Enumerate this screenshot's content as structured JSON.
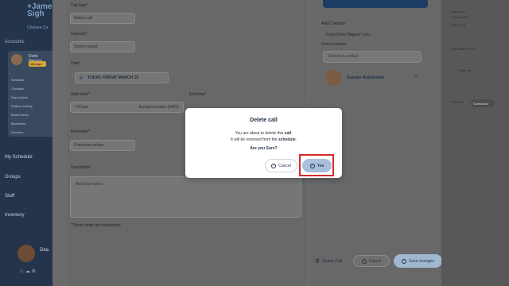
{
  "brand": {
    "logo_line1": "+Jame",
    "logo_line2": "Sigh",
    "subtitle": "Chelsea Ca"
  },
  "sidebar": {
    "accounts_label": "Accounts",
    "user_name": "Doris Hegues",
    "user_badge": "Manage",
    "items": [
      "Schedule",
      "Contacts",
      "Day Actions",
      "Rhibico Activity",
      "Board Items",
      "Biomettics",
      "Services"
    ],
    "nav": [
      "My Schedule",
      "Groups",
      "Staff",
      "Inventory"
    ],
    "footer_name": "Dea"
  },
  "form": {
    "call_type_label": "Call type*",
    "call_type_placeholder": "Select call",
    "repeats_label": "Repeats*",
    "repeats_placeholder": "Select repeat",
    "date_label": "Date*",
    "date_value": "TODAY, FRIDAY MARCH 15",
    "start_time_label": "Start time*",
    "start_time_value": "7:00 pm",
    "timezone": "Europe/London (GMT)",
    "end_time_label": "End time*",
    "reminder_label": "Reminder*",
    "reminder_value": "5 minutes before",
    "description_label": "Description",
    "description_placeholder": "Add description",
    "mandatory_note": "*These fields are mandatory."
  },
  "contacts": {
    "heading": "Add Contacts",
    "from_label": "From Doris Hegues' con...",
    "find_label": "Find a contact",
    "search_placeholder": "Search a contact",
    "person_name": "Duncan Hubbleston"
  },
  "actions": {
    "delete_label": "Delete Call",
    "cancel_label": "Cancel",
    "save_label": "Save changes"
  },
  "right_column": {
    "line1": "ting room",
    "line2": "ences RLD",
    "line3": "ARCH 15",
    "line4": "DAY MARCH 15",
    "filter": "Filter by",
    "time": "6:30 PM",
    "status": "Scheduled"
  },
  "modal": {
    "title": "Delete call",
    "line1_prefix": "You are about to delete this ",
    "line1_bold": "call",
    "line1_suffix": ".",
    "line2_prefix": "It will be removed from the ",
    "line2_bold": "schedule",
    "line2_suffix": ".",
    "question": "Are you Sure?",
    "cancel": "Cancel",
    "yes": "Yes"
  },
  "colors": {
    "sidebar": "#24344b",
    "modal_bg": "#ffffff",
    "yes_button": "#a8c0d9",
    "highlight": "#d22c2c"
  }
}
